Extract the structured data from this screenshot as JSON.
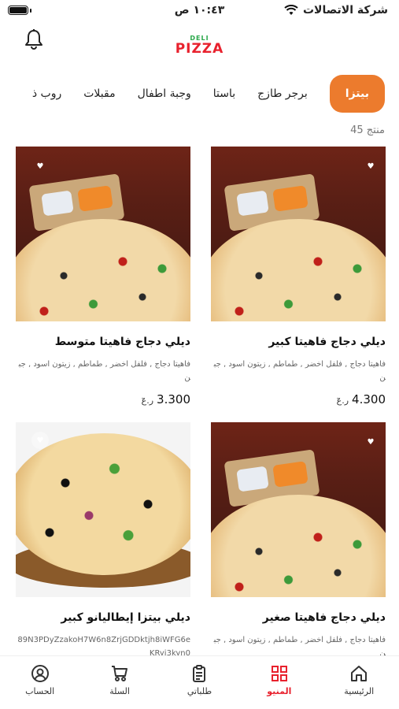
{
  "status_bar": {
    "carrier": "شركة الاتصالات",
    "time": "١٠:٤٣ ص"
  },
  "header": {
    "logo_top": "DELI",
    "logo_main": "PIZZA"
  },
  "categories": [
    {
      "label": "بيتزا",
      "active": true
    },
    {
      "label": "برجر طازج"
    },
    {
      "label": "باستا"
    },
    {
      "label": "وجبة اطفال"
    },
    {
      "label": "مقبلات"
    },
    {
      "label": "روب ذ"
    }
  ],
  "product_count": "منتج 45",
  "products": [
    {
      "name": "ديلي دجاج فاهيتا كبير",
      "description": "فاهيتا دجاج , فلفل اخضر , طماطم , زيتون اسود , جبن",
      "price": "4.300",
      "currency": "ر.عٓ"
    },
    {
      "name": "ديلي دجاج فاهيتا متوسط",
      "description": "فاهيتا دجاج , فلفل اخضر , طماطم , زيتون اسود , جبن",
      "price": "3.300",
      "currency": "ر.عٓ"
    },
    {
      "name": "ديلي دجاج فاهيتا صغير",
      "description": "فاهيتا دجاج , فلفل اخضر , طماطم , زيتون اسود , جبن"
    },
    {
      "name": "ديلي بيتزا إيطاليانو كبير",
      "description": "89N3PDyZzakoH7W6n8ZrjGDDktjh8iWFG6eKRyj3kyn0"
    }
  ],
  "tabs": [
    {
      "label": "الرئيسية"
    },
    {
      "label": "المنيو",
      "active": true
    },
    {
      "label": "طلباتي"
    },
    {
      "label": "السلة"
    },
    {
      "label": "الحساب"
    }
  ],
  "colors": {
    "accent": "#ec7b2d",
    "brand_red": "#e8212d",
    "brand_green": "#2aa84a"
  }
}
